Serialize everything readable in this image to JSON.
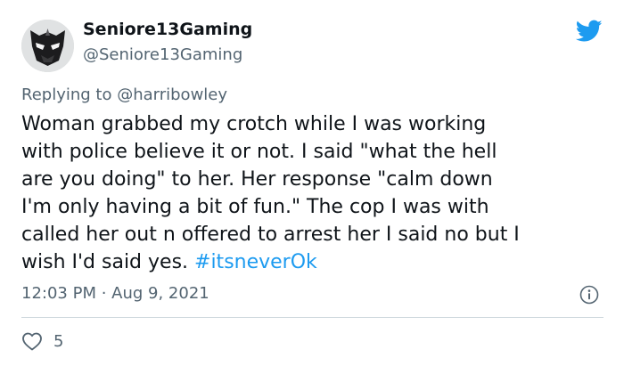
{
  "tweet": {
    "author": {
      "display_name": "Seniore13Gaming",
      "handle": "@Seniore13Gaming"
    },
    "replying_to": {
      "prefix": "Replying to ",
      "mention": "@harribowley"
    },
    "text_lines": [
      "Woman grabbed my crotch while I was working",
      "with police believe it or not. I said \"what the hell",
      "are you doing\" to her. Her response \"calm down",
      "I'm only having a bit of fun.\" The cop I was with",
      "called her out n offered to arrest her I said no but I",
      "wish I'd said yes. "
    ],
    "hashtag": "#itsneverOk",
    "timestamp": "12:03 PM · Aug 9, 2021",
    "likes": "5"
  },
  "icons": {
    "brand": "twitter-bird-icon",
    "info": "info-icon",
    "like": "heart-icon"
  },
  "colors": {
    "accent": "#1d9bf0",
    "secondary_text": "#536471",
    "primary_text": "#0f1419",
    "divider": "#cfd9de"
  }
}
